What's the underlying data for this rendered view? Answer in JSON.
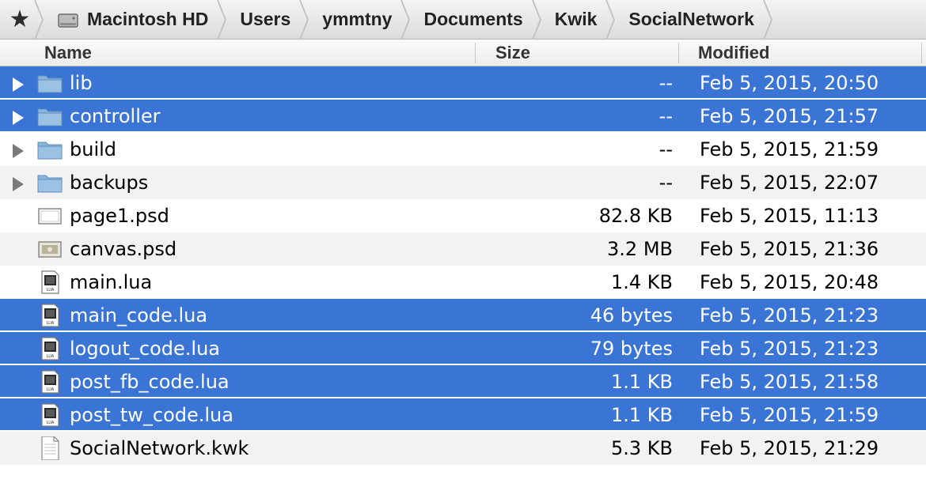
{
  "pathbar": {
    "favorites_icon": "star-icon",
    "crumbs": [
      {
        "label": "Macintosh HD",
        "icon": "hard-drive-icon"
      },
      {
        "label": "Users"
      },
      {
        "label": "ymmtny"
      },
      {
        "label": "Documents"
      },
      {
        "label": "Kwik"
      },
      {
        "label": "SocialNetwork"
      }
    ]
  },
  "columns": {
    "name": "Name",
    "size": "Size",
    "modified": "Modified"
  },
  "colors": {
    "selection": "#3a74d5",
    "alt_row": "#f2f2f2",
    "folder": "#8ab4d8"
  },
  "files": [
    {
      "name": "lib",
      "size": "--",
      "modified": "Feb 5, 2015, 20:50",
      "kind": "folder",
      "selected": true
    },
    {
      "name": "controller",
      "size": "--",
      "modified": "Feb 5, 2015, 21:57",
      "kind": "folder",
      "selected": true
    },
    {
      "name": "build",
      "size": "--",
      "modified": "Feb 5, 2015, 21:59",
      "kind": "folder",
      "selected": false
    },
    {
      "name": "backups",
      "size": "--",
      "modified": "Feb 5, 2015, 22:07",
      "kind": "folder",
      "selected": false
    },
    {
      "name": "page1.psd",
      "size": "82.8 KB",
      "modified": "Feb 5, 2015, 11:13",
      "kind": "psd-blank",
      "selected": false
    },
    {
      "name": "canvas.psd",
      "size": "3.2 MB",
      "modified": "Feb 5, 2015, 21:36",
      "kind": "psd-image",
      "selected": false
    },
    {
      "name": "main.lua",
      "size": "1.4 KB",
      "modified": "Feb 5, 2015, 20:48",
      "kind": "lua",
      "selected": false
    },
    {
      "name": "main_code.lua",
      "size": "46 bytes",
      "modified": "Feb 5, 2015, 21:23",
      "kind": "lua",
      "selected": true
    },
    {
      "name": "logout_code.lua",
      "size": "79 bytes",
      "modified": "Feb 5, 2015, 21:23",
      "kind": "lua",
      "selected": true
    },
    {
      "name": "post_fb_code.lua",
      "size": "1.1 KB",
      "modified": "Feb 5, 2015, 21:58",
      "kind": "lua",
      "selected": true
    },
    {
      "name": "post_tw_code.lua",
      "size": "1.1 KB",
      "modified": "Feb 5, 2015, 21:59",
      "kind": "lua",
      "selected": true
    },
    {
      "name": "SocialNetwork.kwk",
      "size": "5.3 KB",
      "modified": "Feb 5, 2015, 21:29",
      "kind": "document",
      "selected": false
    }
  ]
}
